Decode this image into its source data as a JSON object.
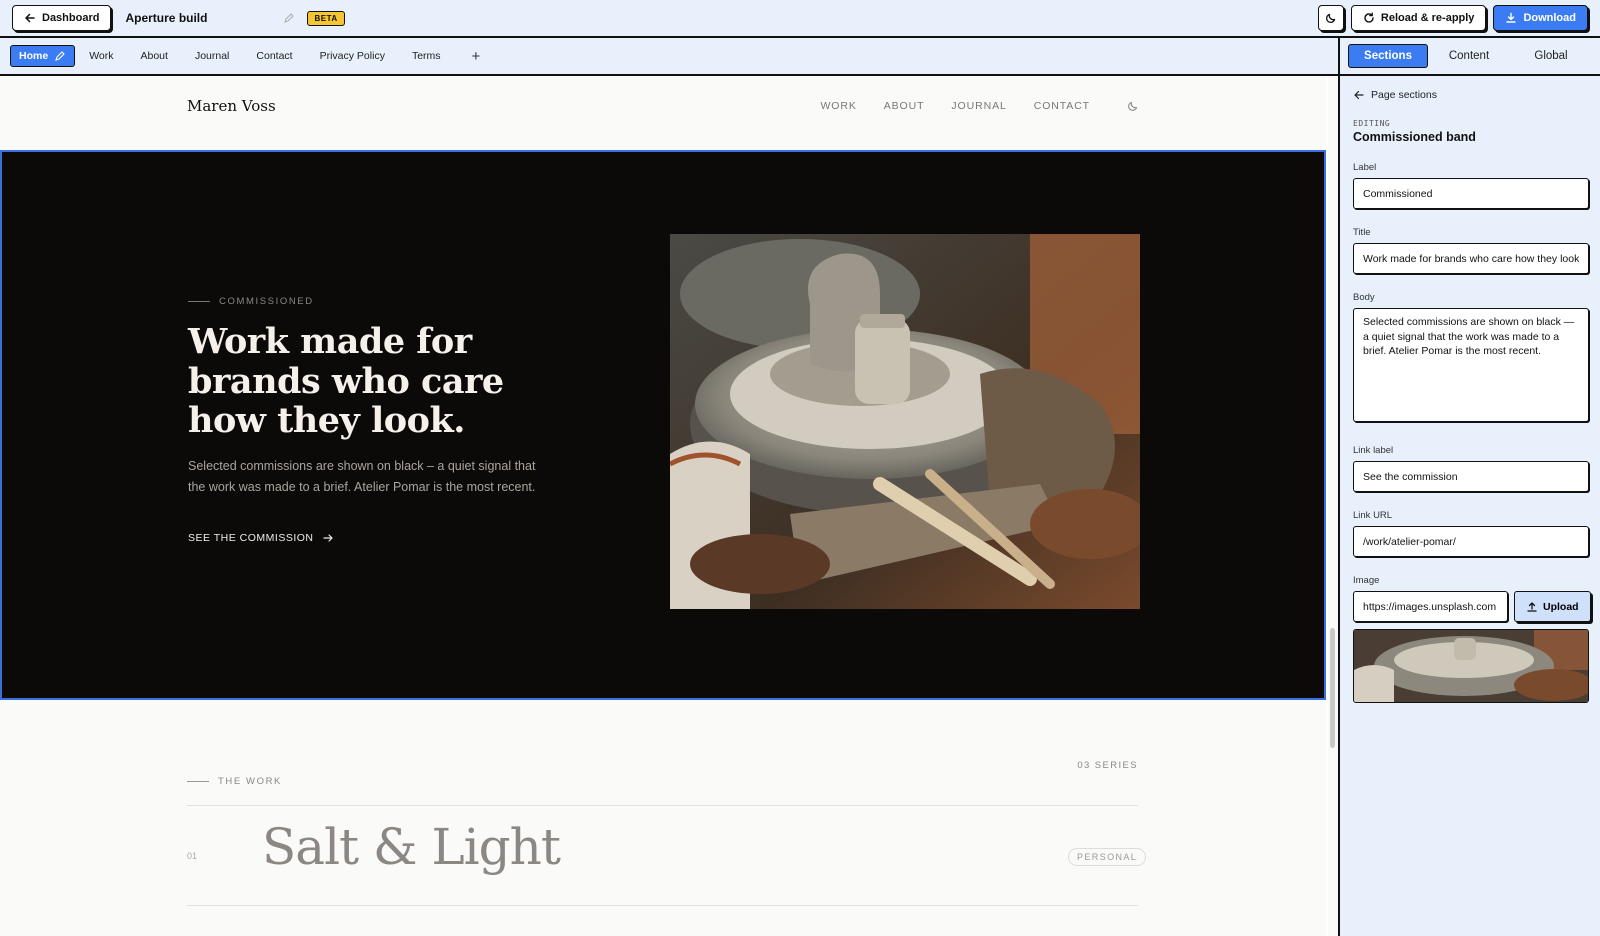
{
  "topbar": {
    "dashboard_label": "Dashboard",
    "project_title": "Aperture build",
    "beta_badge": "BETA",
    "reload_label": "Reload & re-apply",
    "download_label": "Download"
  },
  "pages": {
    "tabs": [
      {
        "label": "Home",
        "active": true
      },
      {
        "label": "Work"
      },
      {
        "label": "About"
      },
      {
        "label": "Journal"
      },
      {
        "label": "Contact"
      },
      {
        "label": "Privacy Policy"
      },
      {
        "label": "Terms"
      }
    ],
    "add_label": "+"
  },
  "panel": {
    "tabs": [
      "Sections",
      "Content",
      "Global"
    ],
    "back_label": "Page sections",
    "editing_label": "EDITING",
    "editing_name": "Commissioned band",
    "fields": {
      "label": {
        "label": "Label",
        "value": "Commissioned"
      },
      "title": {
        "label": "Title",
        "value": "Work made for brands who care how they look."
      },
      "body": {
        "label": "Body",
        "value": "Selected commissions are shown on black — a quiet signal that the work was made to a brief. Atelier Pomar is the most recent."
      },
      "link_label": {
        "label": "Link label",
        "value": "See the commission"
      },
      "link_url": {
        "label": "Link URL",
        "value": "/work/atelier-pomar/"
      },
      "image": {
        "label": "Image",
        "value": "https://images.unsplash.com"
      }
    },
    "upload_label": "Upload"
  },
  "site": {
    "name": "Maren Voss",
    "nav": [
      "WORK",
      "ABOUT",
      "JOURNAL",
      "CONTACT"
    ]
  },
  "band": {
    "eyebrow": "COMMISSIONED",
    "title": "Work made for brands who care how they look.",
    "body": "Selected commissions are shown on black – a quiet signal that the work was made to a brief. Atelier Pomar is the most recent.",
    "link": "SEE THE COMMISSION"
  },
  "work": {
    "eyebrow": "THE WORK",
    "series_count": "03 SERIES",
    "rows": [
      {
        "num": "01",
        "title": "Salt & Light",
        "badge": "PERSONAL"
      }
    ]
  },
  "colors": {
    "accent": "#3b7cf2",
    "chrome_bg": "#e8f0fc",
    "band_bg": "#0c0a09",
    "beta": "#f6c532"
  },
  "icons": {
    "back": "arrow-left-icon",
    "edit": "pencil-icon",
    "theme": "moon-icon",
    "reload": "refresh-icon",
    "download": "download-icon",
    "upload": "upload-icon",
    "link_arrow": "arrow-right-icon"
  }
}
